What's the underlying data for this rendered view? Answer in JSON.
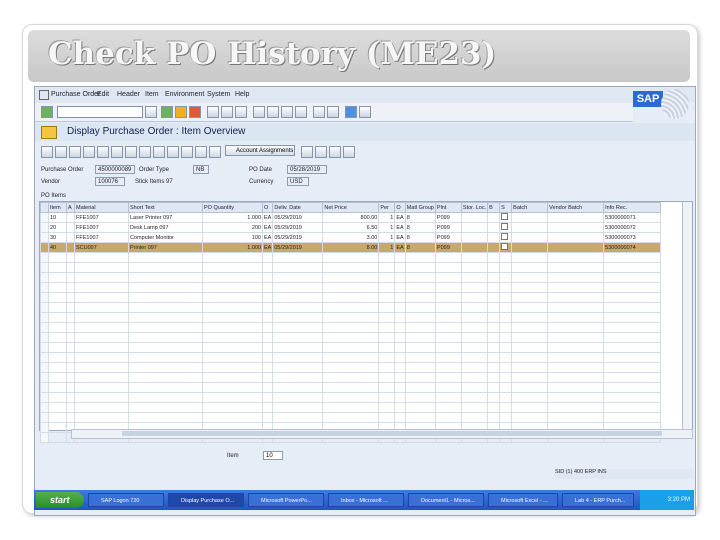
{
  "slide": {
    "title": "Check PO History (ME23)"
  },
  "menu": [
    "Purchase Order",
    "Edit",
    "Header",
    "Item",
    "Environment",
    "System",
    "Help"
  ],
  "logo": "SAP",
  "screen": {
    "title": "Display Purchase Order : Item Overview",
    "account_button": "Account Assignments"
  },
  "header": {
    "po_label": "Purchase Order",
    "po_value": "4500000089",
    "order_type_label": "Order Type",
    "order_type_value": "NB",
    "po_date_label": "PO Date",
    "po_date_value": "05/28/2019",
    "vendor_label": "Vendor",
    "vendor_value": "100076",
    "vendor_name": "Stick Items 97",
    "currency_label": "Currency",
    "currency_value": "USD"
  },
  "grid": {
    "caption": "PO Items",
    "columns": [
      "Item",
      "A",
      "Material",
      "Short Text",
      "PO Quantity",
      "O",
      "Deliv. Date",
      "Net Price",
      "Per",
      "O",
      "Matl Group",
      "Plnt",
      "Stor. Loc.",
      "B",
      "S",
      "Batch",
      "Vendor Batch",
      "Info Rec."
    ],
    "rows": [
      {
        "item": "10",
        "a": "",
        "material": "FFE1007",
        "short": "Laser Printer 097",
        "qty": "1.000",
        "unit": "EA",
        "date": "05/29/2019",
        "price": "800.00",
        "per": "1",
        "ou": "EA",
        "mgroup": "8",
        "plant": "P099",
        "sloc": "",
        "info": "5300000071"
      },
      {
        "item": "20",
        "a": "",
        "material": "FFE1007",
        "short": "Desk Lamp 097",
        "qty": "200",
        "unit": "EA",
        "date": "05/29/2019",
        "price": "6.50",
        "per": "1",
        "ou": "EA",
        "mgroup": "8",
        "plant": "P099",
        "sloc": "",
        "info": "5300000072"
      },
      {
        "item": "30",
        "a": "",
        "material": "FFE1007",
        "short": "Computer Monitor",
        "qty": "100",
        "unit": "EA",
        "date": "05/29/2019",
        "price": "3.00",
        "per": "1",
        "ou": "EA",
        "mgroup": "8",
        "plant": "P099",
        "sloc": "",
        "info": "5300000073"
      },
      {
        "item": "40",
        "a": "",
        "material": "SCU097",
        "short": "Printer 097",
        "qty": "1.000",
        "unit": "EA",
        "date": "05/29/2019",
        "price": "8.00",
        "per": "1",
        "ou": "EA",
        "mgroup": "8",
        "plant": "P099",
        "sloc": "",
        "info": "5300000074"
      }
    ]
  },
  "footer": {
    "item_label": "Item",
    "item_value": "10"
  },
  "status": "SID (1) 400  ERP  INS",
  "taskbar": {
    "start": "start",
    "tasks": [
      "SAP Logon 720",
      "Display Purchase O...",
      "Microsoft PowerPo...",
      "Inbox - Microsoft ...",
      "Document1 - Micros...",
      "Microsoft Excel - ...",
      "Lab 4 - ERP Purch..."
    ],
    "clock": "3:20 PM"
  }
}
